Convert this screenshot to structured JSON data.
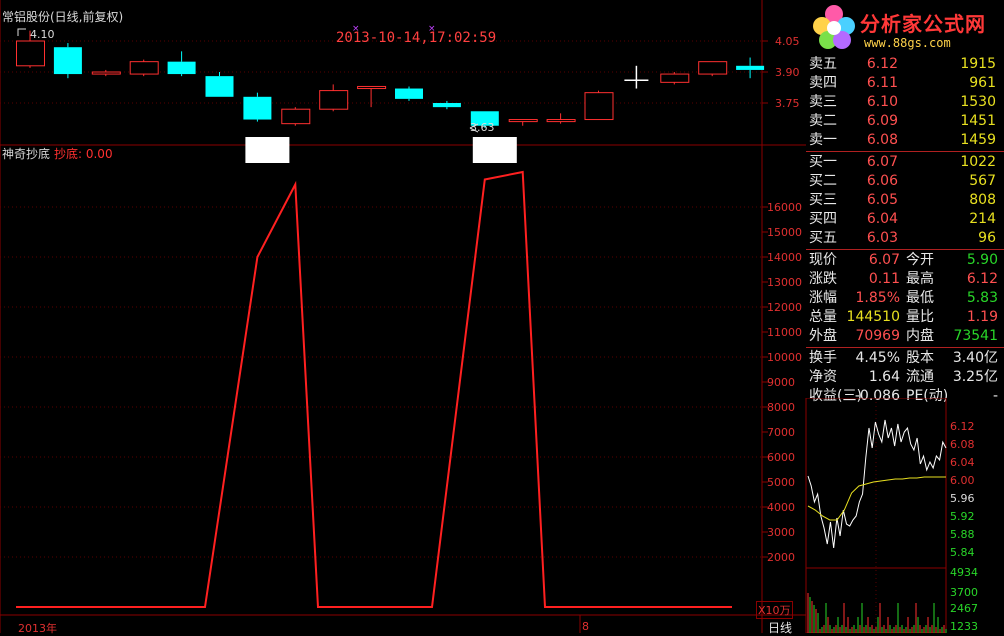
{
  "header": {
    "title": "常铝股份(日线,前复权)",
    "datetime": "2013-10-14,17:02:59",
    "high_label": "4.10",
    "low_label": "3.63"
  },
  "indicator": {
    "name": "神奇抄底",
    "value_label": "抄底: 0.00",
    "unit_label": "X10万"
  },
  "bottom": {
    "year_label": "2013年",
    "month_label": "8",
    "period_label": "日线"
  },
  "logo": {
    "main": "分析家公式网",
    "sub": "www.88gs.com"
  },
  "colors": {
    "up": "#ff3030",
    "down": "#00ffff",
    "indicator": "#ff2020",
    "grid": "#8b0000",
    "yellow": "#e8e020",
    "green": "#29d629"
  },
  "chart_data": [
    {
      "type": "candlestick",
      "y_ticks": [
        "4.05",
        "3.90",
        "3.75"
      ],
      "candles": [
        {
          "o": 3.93,
          "c": 4.05,
          "h": 4.1,
          "l": 3.92,
          "dir": "up"
        },
        {
          "o": 4.02,
          "c": 3.89,
          "h": 4.04,
          "l": 3.87,
          "dir": "down"
        },
        {
          "o": 3.9,
          "c": 3.89,
          "h": 3.91,
          "l": 3.88,
          "dir": "up"
        },
        {
          "o": 3.89,
          "c": 3.95,
          "h": 3.96,
          "l": 3.88,
          "dir": "up"
        },
        {
          "o": 3.95,
          "c": 3.89,
          "h": 4.0,
          "l": 3.88,
          "dir": "down"
        },
        {
          "o": 3.88,
          "c": 3.78,
          "h": 3.9,
          "l": 3.78,
          "dir": "down"
        },
        {
          "o": 3.78,
          "c": 3.67,
          "h": 3.8,
          "l": 3.66,
          "dir": "down"
        },
        {
          "o": 3.65,
          "c": 3.72,
          "h": 3.73,
          "l": 3.64,
          "dir": "up"
        },
        {
          "o": 3.72,
          "c": 3.81,
          "h": 3.84,
          "l": 3.71,
          "dir": "up"
        },
        {
          "o": 3.82,
          "c": 3.83,
          "h": 3.83,
          "l": 3.73,
          "dir": "up"
        },
        {
          "o": 3.82,
          "c": 3.77,
          "h": 3.83,
          "l": 3.76,
          "dir": "down"
        },
        {
          "o": 3.75,
          "c": 3.73,
          "h": 3.76,
          "l": 3.72,
          "dir": "down"
        },
        {
          "o": 3.71,
          "c": 3.64,
          "h": 3.71,
          "l": 3.63,
          "dir": "down"
        },
        {
          "o": 3.66,
          "c": 3.67,
          "h": 3.67,
          "l": 3.64,
          "dir": "up"
        },
        {
          "o": 3.66,
          "c": 3.67,
          "h": 3.7,
          "l": 3.65,
          "dir": "up"
        },
        {
          "o": 3.67,
          "c": 3.8,
          "h": 3.81,
          "l": 3.67,
          "dir": "up"
        },
        {
          "o": 3.86,
          "c": 3.86,
          "h": 3.93,
          "l": 3.82,
          "dir": "doji"
        },
        {
          "o": 3.85,
          "c": 3.89,
          "h": 3.9,
          "l": 3.84,
          "dir": "up"
        },
        {
          "o": 3.89,
          "c": 3.95,
          "h": 3.95,
          "l": 3.88,
          "dir": "up"
        },
        {
          "o": 3.93,
          "c": 3.91,
          "h": 3.97,
          "l": 3.87,
          "dir": "down"
        }
      ]
    },
    {
      "type": "line",
      "name": "抄底",
      "y_ticks": [
        "16000",
        "15000",
        "14000",
        "13000",
        "12000",
        "11000",
        "10000",
        "9000",
        "8000",
        "7000",
        "6000",
        "5000",
        "4000",
        "3000",
        "2000"
      ],
      "points": [
        {
          "i": 5,
          "v": 0
        },
        {
          "i": 6,
          "v": 14000
        },
        {
          "i": 7,
          "v": 16900
        },
        {
          "i": 8,
          "v": 0
        },
        {
          "i": 11,
          "v": 0
        },
        {
          "i": 12,
          "v": 17100
        },
        {
          "i": 13,
          "v": 17400
        },
        {
          "i": 14,
          "v": 0
        },
        {
          "i": 19,
          "v": 0
        }
      ]
    },
    {
      "type": "line",
      "name": "intraday",
      "price_ticks_up": [
        "6.12",
        "6.08",
        "6.04",
        "6.00"
      ],
      "price_ticks_neutral": [
        "5.96"
      ],
      "price_ticks_down": [
        "5.92",
        "5.88",
        "5.84"
      ],
      "volume_ticks": [
        "4934",
        "3700",
        "2467",
        "1233"
      ]
    }
  ],
  "quote_panel": {
    "asks": [
      {
        "label": "卖五",
        "price": "6.12",
        "vol": "1915"
      },
      {
        "label": "卖四",
        "price": "6.11",
        "vol": "961"
      },
      {
        "label": "卖三",
        "price": "6.10",
        "vol": "1530"
      },
      {
        "label": "卖二",
        "price": "6.09",
        "vol": "1451"
      },
      {
        "label": "卖一",
        "price": "6.08",
        "vol": "1459"
      }
    ],
    "bids": [
      {
        "label": "买一",
        "price": "6.07",
        "vol": "1022"
      },
      {
        "label": "买二",
        "price": "6.06",
        "vol": "567"
      },
      {
        "label": "买三",
        "price": "6.05",
        "vol": "808"
      },
      {
        "label": "买四",
        "price": "6.04",
        "vol": "214"
      },
      {
        "label": "买五",
        "price": "6.03",
        "vol": "96"
      }
    ],
    "stats": [
      {
        "l1": "现价",
        "v1": "6.07",
        "c1": "red",
        "l2": "今开",
        "v2": "5.90",
        "c2": "green"
      },
      {
        "l1": "涨跌",
        "v1": "0.11",
        "c1": "red",
        "l2": "最高",
        "v2": "6.12",
        "c2": "red"
      },
      {
        "l1": "涨幅",
        "v1": "1.85%",
        "c1": "red",
        "l2": "最低",
        "v2": "5.83",
        "c2": "green"
      },
      {
        "l1": "总量",
        "v1": "144510",
        "c1": "yellow",
        "l2": "量比",
        "v2": "1.19",
        "c2": "red"
      },
      {
        "l1": "外盘",
        "v1": "70969",
        "c1": "red",
        "l2": "内盘",
        "v2": "73541",
        "c2": "green"
      }
    ],
    "fund": [
      {
        "l1": "换手",
        "v1": "4.45%",
        "l2": "股本",
        "v2": "3.40亿"
      },
      {
        "l1": "净资",
        "v1": "1.64",
        "l2": "流通",
        "v2": "3.25亿"
      },
      {
        "l1": "收益(三)",
        "v1": "-0.086",
        "l2": "PE(动)",
        "v2": "-"
      }
    ]
  }
}
